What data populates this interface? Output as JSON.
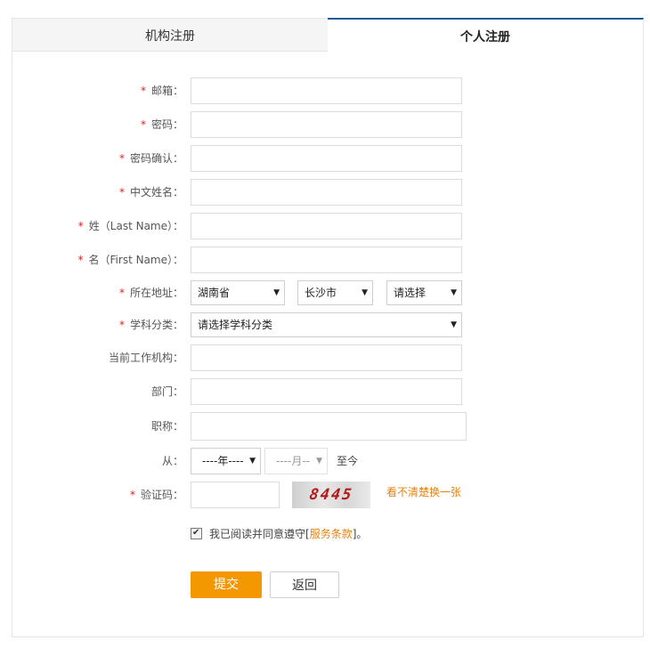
{
  "tabs": [
    {
      "label": "机构注册",
      "active": false
    },
    {
      "label": "个人注册",
      "active": true
    }
  ],
  "form": {
    "required_mark": "*",
    "email_label": "邮箱：",
    "password_label": "密码：",
    "confirm_label": "密码确认：",
    "cn_name_label": "中文姓名：",
    "last_name_label": "姓（Last Name）：",
    "first_name_label": "名（First Name）：",
    "address_label": "所在地址：",
    "province_value": "湖南省",
    "city_value": "长沙市",
    "district_value": "请选择",
    "subject_label": "学科分类：",
    "subject_value": "请选择学科分类",
    "org_label": "当前工作机构：",
    "dept_label": "部门：",
    "title_label": "职称：",
    "from_label": "从：",
    "year_value": "----年----",
    "month_value": "----月--",
    "to_text": "至今",
    "captcha_label": "验证码：",
    "captcha_image_text": "8445",
    "captcha_refresh": "看不清楚换一张",
    "agree_text": "我已阅读并同意遵守[",
    "agree_link": "服务条款",
    "agree_suffix": "]。",
    "agree_checked": true,
    "submit_label": "提交",
    "back_label": "返回"
  },
  "colors": {
    "accent": "#f39800",
    "required": "#dd2222",
    "tab_border": "#1f5a8f",
    "link": "#e8800c"
  },
  "icons": {
    "select_arrow": "triangle-down-icon",
    "checkbox": "checkmark-icon"
  }
}
